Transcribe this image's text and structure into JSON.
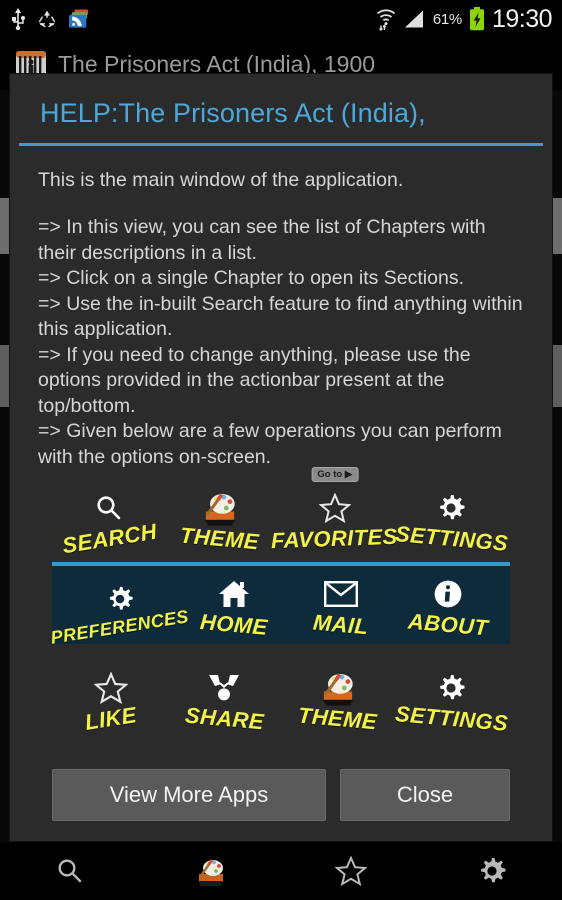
{
  "statusbar": {
    "icons_left": [
      "usb-icon",
      "sync-recycle-icon",
      "news-feed-icon"
    ],
    "wifi_icon": "wifi-updown-icon",
    "signal_icon": "cell-signal-icon",
    "battery_percent": "61%",
    "battery_icon": "battery-charging-icon",
    "clock": "19:30"
  },
  "app": {
    "icon": "prison-bars-icon",
    "title": "The Prisoners Act (India), 1900"
  },
  "dialog": {
    "title": "HELP:The Prisoners Act (India),",
    "intro": "This is the main window of the application.",
    "bullets": [
      " => In this view, you can see the list of Chapters with their descriptions in a list.",
      " => Click on a single Chapter to open its Sections.",
      " => Use the in-built Search feature to find anything within this application.",
      " => If you need to change anything, please use the options provided in the actionbar present at the top/bottom.",
      " => Given below are a few operations you can perform with the options on-screen."
    ],
    "rows": [
      {
        "name": "top-actions",
        "items": [
          {
            "label": "SEARCH",
            "icon": "search-icon"
          },
          {
            "label": "THEME",
            "icon": "palette-theme-icon"
          },
          {
            "label": "FAVORITES",
            "icon": "star-outline-icon",
            "badge": "Go to ▶"
          },
          {
            "label": "SETTINGS",
            "icon": "gear-icon"
          }
        ]
      },
      {
        "name": "actionbar-panel",
        "items": [
          {
            "label": "PREFERENCES",
            "icon": "gear-icon"
          },
          {
            "label": "HOME",
            "icon": "home-icon"
          },
          {
            "label": "MAIL",
            "icon": "mail-envelope-icon"
          },
          {
            "label": "ABOUT",
            "icon": "info-circle-icon"
          }
        ]
      },
      {
        "name": "bottom-actions",
        "items": [
          {
            "label": "LIKE",
            "icon": "star-outline-icon"
          },
          {
            "label": "SHARE",
            "icon": "share-icon"
          },
          {
            "label": "THEME",
            "icon": "palette-theme-icon"
          },
          {
            "label": "SETTINGS",
            "icon": "gear-icon"
          }
        ]
      }
    ],
    "buttons": {
      "primary": "View More Apps",
      "secondary": "Close"
    }
  },
  "bottombar": {
    "items": [
      {
        "name": "search",
        "icon": "search-icon"
      },
      {
        "name": "theme",
        "icon": "palette-theme-icon"
      },
      {
        "name": "favorites",
        "icon": "star-outline-icon"
      },
      {
        "name": "settings",
        "icon": "gear-icon"
      }
    ]
  },
  "colors": {
    "accent_blue": "#3f9ec9",
    "label_yellow": "#f2f24a",
    "panel_navy": "#0e2b3c",
    "dialog_bg": "#2b2b2b",
    "battery_green": "#8ed400"
  }
}
